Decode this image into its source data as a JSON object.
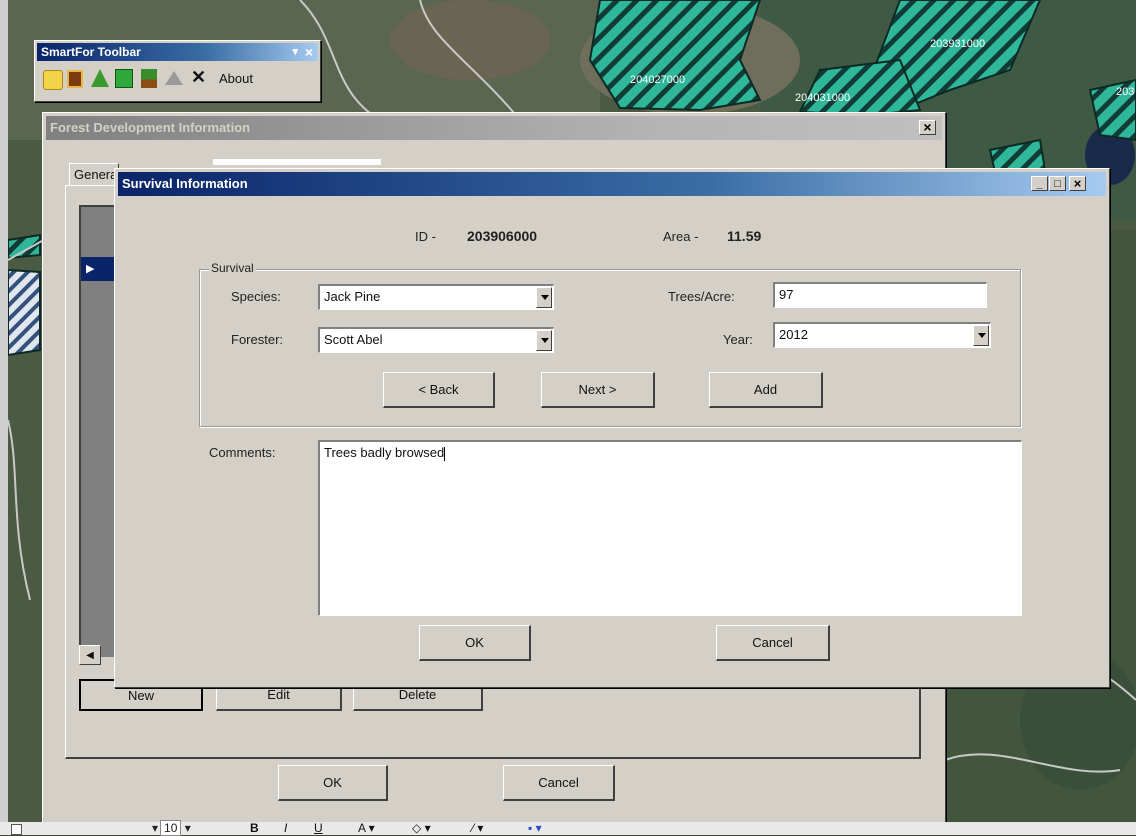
{
  "map": {
    "parcel_labels": [
      "203931000",
      "204027000",
      "204031000",
      "203"
    ]
  },
  "toolbar": {
    "title": "SmartFor Toolbar",
    "close_glyph": "×",
    "menu_glyph": "▾",
    "about_label": "About",
    "icons": [
      "new-icon",
      "open-icon",
      "tree-icon",
      "green-tree-icon",
      "plant-icon",
      "house-icon",
      "delete-icon"
    ]
  },
  "forest_dialog": {
    "title": "Forest Development Information",
    "close_glyph": "×",
    "tab_label": "General",
    "buttons": {
      "new": "New",
      "edit": "Edit",
      "delete": "Delete",
      "ok": "OK",
      "cancel": "Cancel"
    }
  },
  "survival_dialog": {
    "title": "Survival Information",
    "id_label": "ID -",
    "id_value": "203906000",
    "area_label": "Area -",
    "area_value": "11.59",
    "group_title": "Survival",
    "species_label": "Species:",
    "species_value": "Jack Pine",
    "forester_label": "Forester:",
    "forester_value": "Scott Abel",
    "trees_label": "Trees/Acre:",
    "trees_value": "97",
    "year_label": "Year:",
    "year_value": "2012",
    "back_label": "< Back",
    "next_label": "Next >",
    "add_label": "Add",
    "comments_label": "Comments:",
    "comments_value": "Trees badly browsed",
    "ok_label": "OK",
    "cancel_label": "Cancel"
  },
  "bottom_bar": {
    "font_size": "10"
  }
}
